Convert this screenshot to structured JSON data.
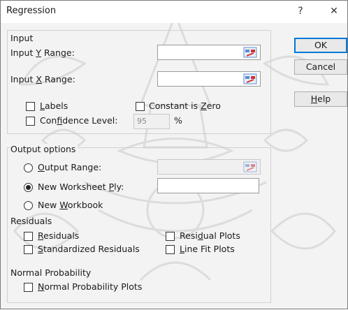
{
  "window": {
    "title": "Regression",
    "help_glyph": "?",
    "close_glyph": "✕"
  },
  "buttons": {
    "ok": "OK",
    "cancel": "Cancel",
    "help": "Help"
  },
  "input": {
    "group_label": "Input",
    "y_range_label": "Input Y Range:",
    "x_range_label": "Input X Range:",
    "y_range_value": "",
    "x_range_value": "",
    "labels_label": "Labels",
    "labels_checked": false,
    "constant_zero_label": "Constant is Zero",
    "constant_zero_checked": false,
    "confidence_label": "Confidence Level:",
    "confidence_checked": false,
    "confidence_value": "95",
    "confidence_unit": "%"
  },
  "output": {
    "group_label": "Output options",
    "output_range_label": "Output Range:",
    "output_range_value": "",
    "new_worksheet_label": "New Worksheet Ply:",
    "new_worksheet_value": "",
    "new_workbook_label": "New Workbook",
    "selected": "new_worksheet"
  },
  "residuals": {
    "group_label": "Residuals",
    "residuals_label": "Residuals",
    "standardized_label": "Standardized Residuals",
    "residual_plots_label": "Residual Plots",
    "line_fit_label": "Line Fit Plots"
  },
  "normal_probability": {
    "group_label": "Normal Probability",
    "plots_label": "Normal Probability Plots"
  },
  "icons": {
    "range_selector": "range-selector-icon",
    "help": "help-icon",
    "close": "close-icon"
  },
  "colors": {
    "default_button_border": "#0078d7",
    "dialog_bg": "#f3f3f3"
  }
}
